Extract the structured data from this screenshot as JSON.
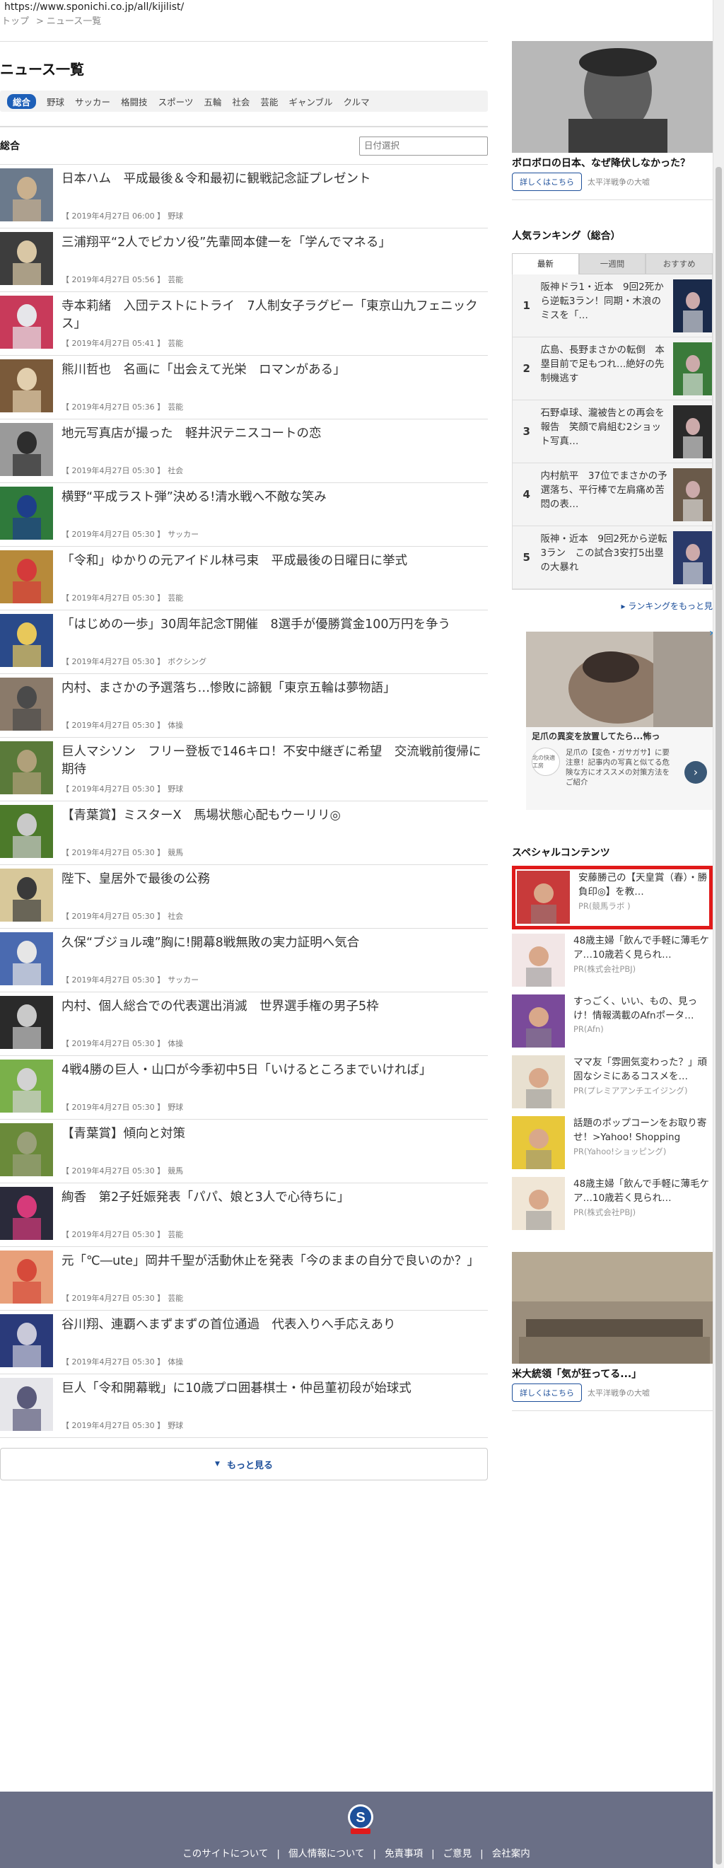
{
  "url": "https://www.sponichi.co.jp/all/kijilist/",
  "breadcrumb": {
    "home": "トップ",
    "current": "ニュース一覧"
  },
  "page_title": "ニュース一覧",
  "genres": [
    "総合",
    "野球",
    "サッカー",
    "格闘技",
    "スポーツ",
    "五輪",
    "社会",
    "芸能",
    "ギャンブル",
    "クルマ"
  ],
  "section_title": "総合",
  "date_placeholder": "日付選択",
  "news": [
    {
      "title": "日本ハム　平成最後＆令和最初に観戦記念証プレゼント",
      "date": "【 2019年4月27日 06:00 】",
      "cat": "野球"
    },
    {
      "title": "三浦翔平“2人でピカソ役”先輩岡本健一を「学んでマネる」",
      "date": "【 2019年4月27日 05:56 】",
      "cat": "芸能"
    },
    {
      "title": "寺本莉緒　入団テストにトライ　7人制女子ラグビー「東京山九フェニックス」",
      "date": "【 2019年4月27日 05:41 】",
      "cat": "芸能"
    },
    {
      "title": "熊川哲也　名画に「出会えて光栄　ロマンがある」",
      "date": "【 2019年4月27日 05:36 】",
      "cat": "芸能"
    },
    {
      "title": "地元写真店が撮った　軽井沢テニスコートの恋",
      "date": "【 2019年4月27日 05:30 】",
      "cat": "社会"
    },
    {
      "title": "横野“平成ラスト弾”決める!清水戦へ不敵な笑み",
      "date": "【 2019年4月27日 05:30 】",
      "cat": "サッカー"
    },
    {
      "title": "「令和」ゆかりの元アイドル林弓束　平成最後の日曜日に挙式",
      "date": "【 2019年4月27日 05:30 】",
      "cat": "芸能"
    },
    {
      "title": "「はじめの一歩」30周年記念T開催　8選手が優勝賞金100万円を争う",
      "date": "【 2019年4月27日 05:30 】",
      "cat": "ボクシング"
    },
    {
      "title": "内村、まさかの予選落ち…惨敗に諦観「東京五輪は夢物語」",
      "date": "【 2019年4月27日 05:30 】",
      "cat": "体操"
    },
    {
      "title": "巨人マシソン　フリー登板で146キロ！不安中継ぎに希望　交流戦前復帰に期待",
      "date": "【 2019年4月27日 05:30 】",
      "cat": "野球"
    },
    {
      "title": "【青葉賞】ミスターX　馬場状態心配もウーリリ◎",
      "date": "【 2019年4月27日 05:30 】",
      "cat": "競馬"
    },
    {
      "title": "陛下、皇居外で最後の公務",
      "date": "【 2019年4月27日 05:30 】",
      "cat": "社会"
    },
    {
      "title": "久保“ブジョル魂”胸に!開幕8戦無敗の実力証明へ気合",
      "date": "【 2019年4月27日 05:30 】",
      "cat": "サッカー"
    },
    {
      "title": "内村、個人総合での代表選出消滅　世界選手権の男子5枠",
      "date": "【 2019年4月27日 05:30 】",
      "cat": "体操"
    },
    {
      "title": "4戦4勝の巨人・山口が今季初中5日「いけるところまでいければ」",
      "date": "【 2019年4月27日 05:30 】",
      "cat": "野球"
    },
    {
      "title": "【青葉賞】傾向と対策",
      "date": "【 2019年4月27日 05:30 】",
      "cat": "競馬"
    },
    {
      "title": "絢香　第2子妊娠発表「パパ、娘と3人で心待ちに」",
      "date": "【 2019年4月27日 05:30 】",
      "cat": "芸能"
    },
    {
      "title": "元「℃―ute」岡井千聖が活動休止を発表「今のままの自分で良いのか？」",
      "date": "【 2019年4月27日 05:30 】",
      "cat": "芸能"
    },
    {
      "title": "谷川翔、連覇へまずまずの首位通過　代表入りへ手応えあり",
      "date": "【 2019年4月27日 05:30 】",
      "cat": "体操"
    },
    {
      "title": "巨人「令和開幕戦」に10歳プロ囲碁棋士・仲邑菫初段が始球式",
      "date": "【 2019年4月27日 05:30 】",
      "cat": "野球"
    }
  ],
  "more_label": "もっと見る",
  "side_ad1": {
    "title": "ボロボロの日本、なぜ降伏しなかった？",
    "button": "詳しくはこちら",
    "source": "太平洋戦争の大嘘"
  },
  "ranking": {
    "heading": "人気ランキング（総合）",
    "tabs": [
      "最新",
      "一週間",
      "おすすめ"
    ],
    "items": [
      {
        "num": "1",
        "text": "阪神ドラ1・近本　9回2死から逆転3ラン！同期・木浪のミスを「…"
      },
      {
        "num": "2",
        "text": "広島、長野まさかの転倒　本塁目前で足もつれ…絶好の先制機逃す"
      },
      {
        "num": "3",
        "text": "石野卓球、瀧被告との再会を報告　笑顔で肩組む2ショット写真…"
      },
      {
        "num": "4",
        "text": "内村航平　37位でまさかの予選落ち、平行棒で左肩痛め苦悶の表…"
      },
      {
        "num": "5",
        "text": "阪神・近本　9回2死から逆転3ラン　この試合3安打5出塁の大暴れ"
      }
    ],
    "more": "ランキングをもっと見"
  },
  "native_ad": {
    "title": "足爪の異変を放置してたら...怖っ",
    "logo": "北の快適工房",
    "text": "足爪の【変色・ガサガサ】に要注意！記事内の写真と似てる危険な方にオススメの対策方法をご紹介"
  },
  "special": {
    "heading": "スペシャルコンテンツ",
    "items": [
      {
        "title": "安藤勝己の【天皇賞（春）・勝負印◎】を教…",
        "pr": "PR(競馬ラボ )"
      },
      {
        "title": "48歳主婦「飲んで手軽に薄毛ケア…10歳若く見られ…",
        "pr": "PR(株式会社PBJ)"
      },
      {
        "title": "すっごく、いい、もの、見っけ！情報満載のAfnポータ…",
        "pr": "PR(Afn)"
      },
      {
        "title": "ママ友「雰囲気変わった？」頑固なシミにあるコスメを…",
        "pr": "PR(プレミアアンチエイジング)"
      },
      {
        "title": "話題のポップコーンをお取り寄せ！>Yahoo! Shopping",
        "pr": "PR(Yahoo!ショッピング)"
      },
      {
        "title": "48歳主婦「飲んで手軽に薄毛ケア…10歳若く見られ…",
        "pr": "PR(株式会社PBJ)"
      }
    ]
  },
  "side_ad2": {
    "title": "米大統領「気が狂ってる...」",
    "button": "詳しくはこちら",
    "source": "太平洋戦争の大嘘"
  },
  "footer": {
    "links": [
      "このサイトについて",
      "個人情報について",
      "免責事項",
      "ご意見",
      "会社案内"
    ]
  }
}
